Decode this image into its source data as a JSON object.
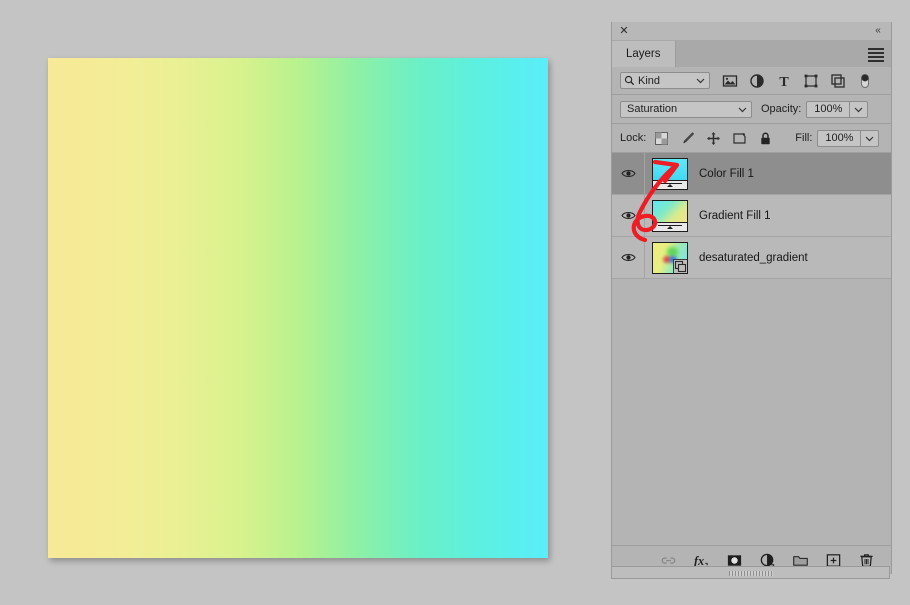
{
  "app": {
    "background_color": "#c4c4c4"
  },
  "canvas": {
    "name": "document-canvas",
    "gradient_description": "horizontal gradient yellow to cyan",
    "colors": [
      "#f7e998",
      "#ecf095",
      "#b8f28e",
      "#8ef0a6",
      "#5cf0e0",
      "#59eefa"
    ]
  },
  "panel": {
    "titlebar": {
      "close_label": "✕",
      "collapse_label": "«"
    },
    "tabs": [
      {
        "label": "Layers",
        "active": true
      }
    ],
    "menu_icon": "hamburger-menu-icon",
    "filter_row": {
      "search_icon": "search-icon",
      "kind_value": "Kind",
      "icons": [
        {
          "name": "filter-pixel-layers-icon"
        },
        {
          "name": "filter-adjustment-layers-icon"
        },
        {
          "name": "filter-type-layers-icon"
        },
        {
          "name": "filter-shape-layers-icon"
        },
        {
          "name": "filter-smart-object-layers-icon"
        },
        {
          "name": "filter-toggle-switch-icon"
        }
      ]
    },
    "blend_row": {
      "blend_mode": "Saturation",
      "opacity_label": "Opacity:",
      "opacity_value": "100%"
    },
    "lock_row": {
      "lock_label": "Lock:",
      "icons": [
        {
          "name": "lock-transparent-pixels-icon"
        },
        {
          "name": "lock-image-pixels-icon"
        },
        {
          "name": "lock-position-icon"
        },
        {
          "name": "lock-artboard-nesting-icon"
        },
        {
          "name": "lock-all-icon"
        }
      ],
      "fill_label": "Fill:",
      "fill_value": "100%"
    },
    "layers": [
      {
        "name": "Color Fill 1",
        "visible": true,
        "selected": true,
        "thumb_type": "solid-fill",
        "thumb_color": "#4ee3f5",
        "has_mask_bar": true,
        "smart_object": false
      },
      {
        "name": "Gradient Fill 1",
        "visible": true,
        "selected": false,
        "thumb_type": "gradient-fill",
        "thumb_color": "#58e8f0",
        "has_mask_bar": true,
        "smart_object": false
      },
      {
        "name": "desaturated_gradient",
        "visible": true,
        "selected": false,
        "thumb_type": "image",
        "thumb_color": "#ecec7a",
        "has_mask_bar": false,
        "smart_object": true
      }
    ],
    "footer": {
      "icons": [
        {
          "name": "link-layers-icon",
          "disabled": true
        },
        {
          "name": "layer-style-fx-icon",
          "disabled": false
        },
        {
          "name": "add-layer-mask-icon",
          "disabled": false
        },
        {
          "name": "new-adjustment-layer-icon",
          "disabled": false
        },
        {
          "name": "new-group-icon",
          "disabled": false
        },
        {
          "name": "new-layer-icon",
          "disabled": false
        },
        {
          "name": "delete-layer-icon",
          "disabled": false
        }
      ]
    },
    "grip": {
      "name": "panel-resize-grip"
    }
  },
  "annotation": {
    "name": "red-arrow-annotation",
    "color": "#ee1c24",
    "description": "red hand-drawn arrow pointing to Color Fill 1 layer thumbnail"
  }
}
